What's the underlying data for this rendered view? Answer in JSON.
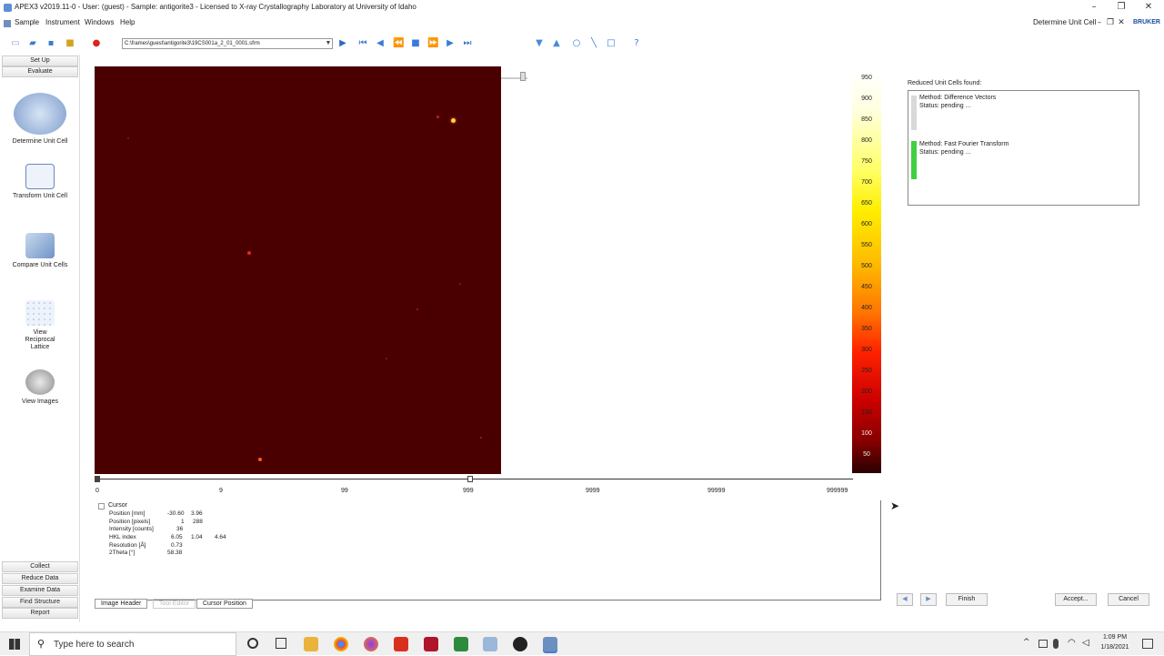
{
  "window": {
    "title": "APEX3 v2019.11-0 - User: (guest) - Sample: antigorite3 - Licensed to X-ray Crystallography Laboratory at University of Idaho",
    "right_label": "Determine Unit Cell",
    "brand": "BRUKER"
  },
  "menu": [
    "Sample",
    "Instrument",
    "Windows",
    "Help"
  ],
  "toolbar": {
    "path": "C:\\frames\\guest\\antigorite3\\19CS001a_2_01_0001.sfrm"
  },
  "sidebar": {
    "top_buttons": [
      "Set Up",
      "Evaluate"
    ],
    "tools": [
      {
        "label": "Determine Unit Cell",
        "icon": "unit-cell-icon"
      },
      {
        "label": "Transform Unit Cell",
        "icon": "transform-icon"
      },
      {
        "label": "Compare Unit Cells",
        "icon": "compare-icon"
      },
      {
        "label": "View Reciprocal Lattice",
        "icon": "lattice-icon"
      },
      {
        "label": "View Images",
        "icon": "images-icon"
      }
    ],
    "bottom_buttons": [
      "Collect",
      "Reduce Data",
      "Examine Data",
      "Find Structure",
      "Report"
    ]
  },
  "scale": {
    "ticks": [
      "0",
      "9",
      "99",
      "999",
      "9999",
      "99999",
      "999999"
    ]
  },
  "colorbar": {
    "labels": [
      "950",
      "900",
      "850",
      "800",
      "750",
      "700",
      "650",
      "600",
      "550",
      "500",
      "450",
      "400",
      "350",
      "300",
      "250",
      "200",
      "150",
      "100",
      "50"
    ]
  },
  "reduced": {
    "heading": "Reduced Unit Cells found:",
    "methods": [
      {
        "method": "Method: Difference Vectors",
        "status": "Status: pending ...",
        "color": "#d9d9d9"
      },
      {
        "method": "Method: Fast Fourier Transform",
        "status": "Status: pending ...",
        "color": "#3fd13f"
      }
    ]
  },
  "cursor": {
    "root": "Cursor",
    "rows": [
      {
        "label": "Position [mm]",
        "v1": "-30.60",
        "v2": "3.96",
        "v3": ""
      },
      {
        "label": "Position [pixels]",
        "v1": "1",
        "v2": "288",
        "v3": ""
      },
      {
        "label": "Intensity [counts]",
        "v1": "36",
        "v2": "",
        "v3": ""
      },
      {
        "label": "HKL index",
        "v1": "6.05",
        "v2": "1.04",
        "v3": "4.64"
      },
      {
        "label": "Resolution [Å]",
        "v1": "0.73",
        "v2": "",
        "v3": ""
      },
      {
        "label": "2Theta [°]",
        "v1": "58.38",
        "v2": "",
        "v3": ""
      }
    ]
  },
  "tabs": [
    "Image Header",
    "Tool Editor",
    "Cursor Position"
  ],
  "actions": {
    "finish": "Finish",
    "accept": "Accept...",
    "cancel": "Cancel"
  },
  "taskbar": {
    "search": "Type here to search",
    "time": "1:09 PM",
    "date": "1/18/2021"
  }
}
